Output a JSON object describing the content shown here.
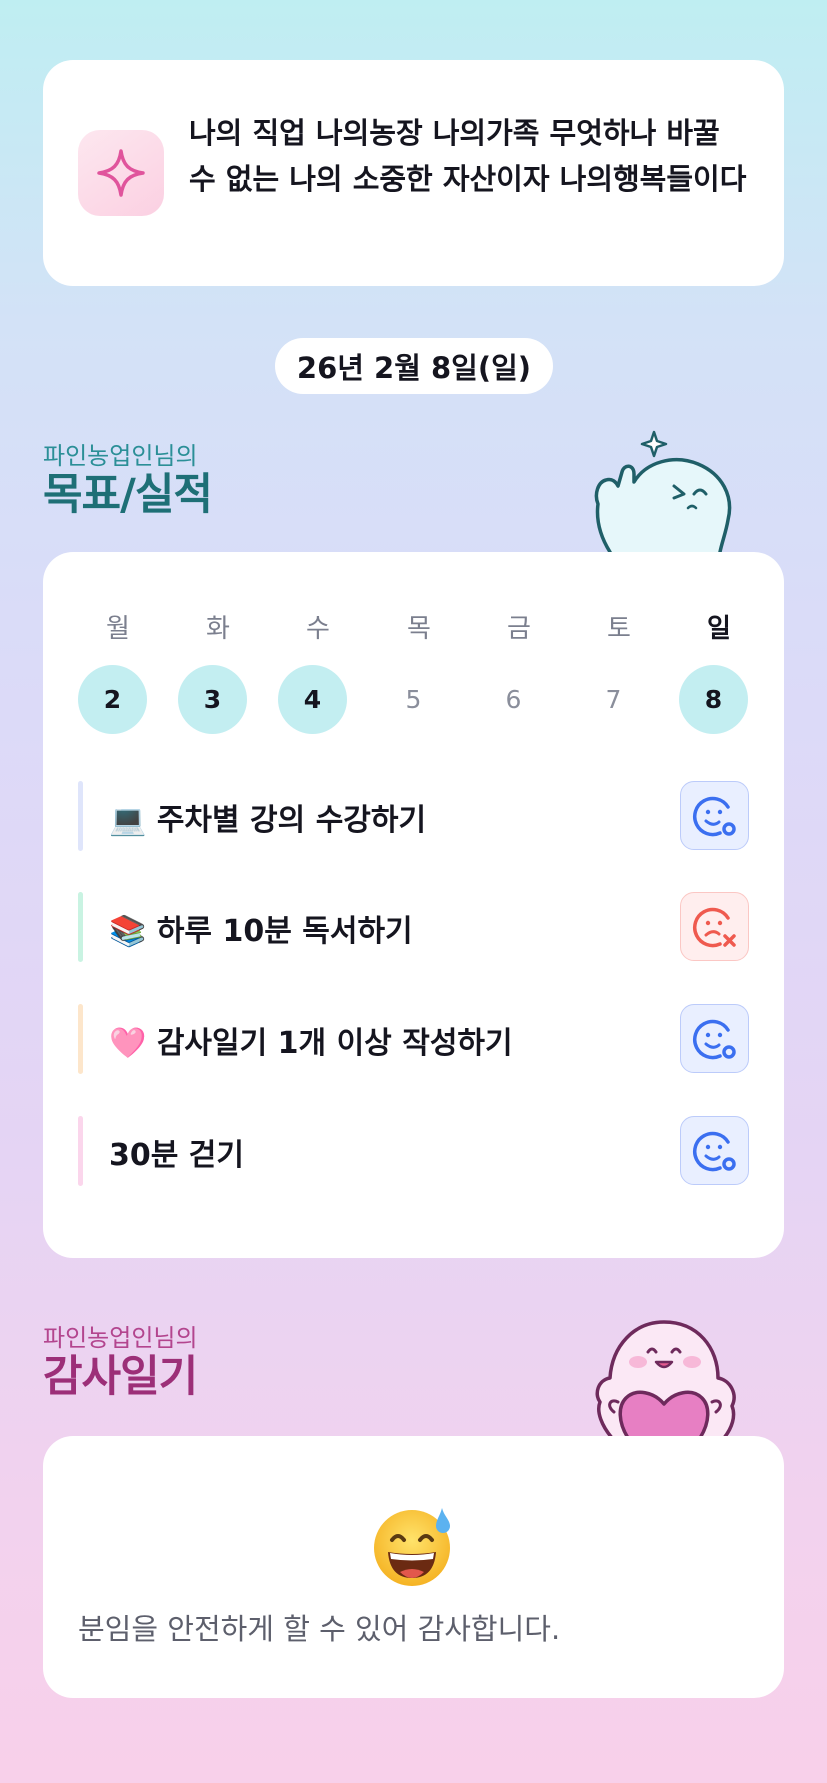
{
  "quote": {
    "icon": "sparkle-icon",
    "text": "나의 직업 나의농장 나의가족 무엇하나 바꿀 수 없는 나의 소중한 자산이자 나의행복들이다"
  },
  "date": "26년 2월 8일(일)",
  "goals_section": {
    "subtitle": "파인농업인님의",
    "title": "목표/실적",
    "mascot": "waving-ghost-mascot"
  },
  "week": {
    "days": [
      {
        "label": "월",
        "num": "2",
        "done": true
      },
      {
        "label": "화",
        "num": "3",
        "done": true
      },
      {
        "label": "수",
        "num": "4",
        "done": true
      },
      {
        "label": "목",
        "num": "5",
        "done": false
      },
      {
        "label": "금",
        "num": "6",
        "done": false
      },
      {
        "label": "토",
        "num": "7",
        "done": false
      },
      {
        "label": "일",
        "num": "8",
        "done": true
      }
    ],
    "today_index": 6
  },
  "goals": [
    {
      "emoji": "💻",
      "text": "주차별 강의 수강하기",
      "bar_color": "#dfe5fb",
      "status": "ok",
      "status_icon": "smile-check-icon"
    },
    {
      "emoji": "📚",
      "text": "하루 10분 독서하기",
      "bar_color": "#c9f3e2",
      "status": "fail",
      "status_icon": "sad-x-icon"
    },
    {
      "emoji": "🩷",
      "text": "감사일기 1개 이상 작성하기",
      "bar_color": "#fde6cb",
      "status": "ok",
      "status_icon": "smile-check-icon"
    },
    {
      "emoji": "",
      "text": "30분 걷기",
      "bar_color": "#fbd6ec",
      "status": "ok",
      "status_icon": "smile-check-icon"
    }
  ],
  "thanks_section": {
    "subtitle": "파인농업인님의",
    "title": "감사일기",
    "mascot": "heart-holding-mascot",
    "emoji": "grinning-sweat-emoji",
    "text": "분임을 안전하게 할 수 있어 감사합니다."
  },
  "colors": {
    "ok_blue": "#3b6ff0",
    "fail_red": "#ef5a4f",
    "goal_heading": "#1e6f76",
    "thanks_heading": "#9c2f78"
  }
}
